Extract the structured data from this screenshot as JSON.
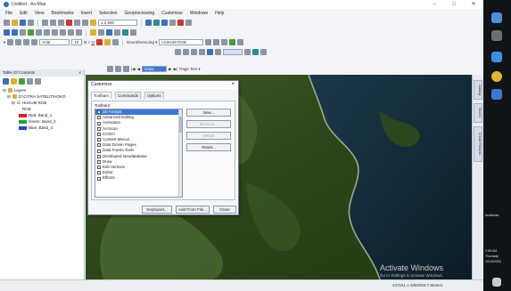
{
  "window": {
    "title": "Untitled - ArcMap"
  },
  "menu": [
    "File",
    "Edit",
    "View",
    "Bookmarks",
    "Insert",
    "Selection",
    "Geoprocessing",
    "Customize",
    "Windows",
    "Help"
  ],
  "toolbar": {
    "scale": "1:2,500",
    "georef_label": "Georeferencing ▾",
    "georef_layer": "HUKUM RGB",
    "font_combo": "Arial",
    "font_size": "10",
    "select_combo": "Draw Label",
    "page_text": "Page Text ▾"
  },
  "toc": {
    "header": "Table Of Contents",
    "close": "×",
    "tree": [
      {
        "label": "Layers",
        "level": 0
      },
      {
        "label": "D:\\CITRA SATELIT\\HOKO",
        "level": 1
      },
      {
        "label": "HUKUM RGB",
        "level": 2
      },
      {
        "label": "RGB",
        "level": 3
      },
      {
        "label": "Red:   Band_1",
        "level": 3,
        "swatch": "#d8232a"
      },
      {
        "label": "Green: Band_2",
        "level": 3,
        "swatch": "#1fa33a"
      },
      {
        "label": "Blue:  Band_3",
        "level": 3,
        "swatch": "#2440c8"
      }
    ]
  },
  "dialog": {
    "title": "Customize",
    "close": "×",
    "tabs": [
      "Toolbars",
      "Commands",
      "Options"
    ],
    "list_label": "Toolbars:",
    "items": [
      {
        "label": "3D Analyst",
        "selected": true
      },
      {
        "label": "Advanced Editing",
        "selected": false
      },
      {
        "label": "Animation",
        "selected": false
      },
      {
        "label": "ArcScan",
        "selected": false
      },
      {
        "label": "COGO",
        "selected": false
      },
      {
        "label": "Context Menus",
        "selected": false
      },
      {
        "label": "Data Driven Pages",
        "selected": false
      },
      {
        "label": "Data Frame Tools",
        "selected": false
      },
      {
        "label": "Distributed Geodatabase",
        "selected": false
      },
      {
        "label": "Draw",
        "selected": false
      },
      {
        "label": "Edit Vertices",
        "selected": false
      },
      {
        "label": "Editor",
        "selected": false
      },
      {
        "label": "Effects",
        "selected": false
      }
    ],
    "side_buttons": [
      {
        "label": "New...",
        "disabled": false
      },
      {
        "label": "Rename...",
        "disabled": true
      },
      {
        "label": "Delete",
        "disabled": true
      },
      {
        "label": "Reset...",
        "disabled": false
      }
    ],
    "bottom_buttons": [
      "Keyboard...",
      "Add From File...",
      "Close"
    ]
  },
  "right_tabs": [
    "Catalog",
    "Search",
    "Create Features"
  ],
  "watermark": {
    "line1": "Activate Windows",
    "line2": "Go to Settings to activate Windows."
  },
  "status": {
    "coords": "447151.1 9360003.7 Meters"
  },
  "taskbar": {
    "lang": "Andaman",
    "time": "2:55 AM",
    "day": "Thursday",
    "date": "10/15/2020"
  },
  "colors": {
    "accent": "#3a78d4",
    "sea": "#0f2330",
    "forest": "#2f4a1e"
  }
}
